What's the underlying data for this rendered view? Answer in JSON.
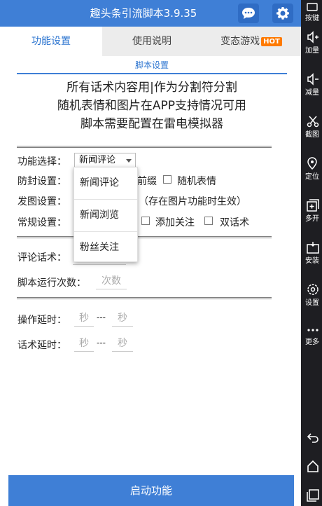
{
  "app": {
    "title": "趣头条引流脚本3.9.35"
  },
  "tabs": [
    {
      "label": "功能设置"
    },
    {
      "label": "使用说明"
    },
    {
      "label": "变态游戏",
      "badge": "HOT"
    }
  ],
  "section_title": "脚本设置",
  "notice": [
    "所有话术内容用|作为分割符分割",
    "随机表情和图片在APP支持情况可用",
    "脚本需要配置在雷电模拟器"
  ],
  "separator": "==========================================",
  "form": {
    "function_label": "功能选择：",
    "function_value": "新闻评论",
    "function_options": [
      "新闻评论",
      "新闻浏览",
      "粉丝关注"
    ],
    "anti_ban_label": "防封设置：",
    "anti_ban_prefix_partial": "前缀",
    "random_emoji": "随机表情",
    "image_label": "发图设置：",
    "image_note": "（存在图片功能时生效）",
    "general_label": "常规设置：",
    "add_follow": "添加关注",
    "double_script": "双话术",
    "comment_script_label": "评论话术：",
    "run_count_label": "脚本运行次数：",
    "run_count_placeholder": "次数",
    "op_delay_label": "操作延时：",
    "script_delay_label": "话术延时：",
    "sec_placeholder": "秒",
    "range_dash": "---"
  },
  "start_button": "启动功能",
  "sidebar": [
    {
      "label": "按键",
      "icon": "keyboard-icon"
    },
    {
      "label": "加量",
      "icon": "volume-up-icon"
    },
    {
      "label": "减量",
      "icon": "volume-down-icon"
    },
    {
      "label": "截图",
      "icon": "scissors-icon"
    },
    {
      "label": "定位",
      "icon": "location-icon"
    },
    {
      "label": "多开",
      "icon": "multi-instance-icon"
    },
    {
      "label": "安装",
      "icon": "apk-install-icon"
    },
    {
      "label": "设置",
      "icon": "settings-gear-icon"
    },
    {
      "label": "更多",
      "icon": "more-dots-icon"
    }
  ],
  "colors": {
    "primary": "#3f7fd6",
    "hot": "#ff7a00",
    "sidebar": "#1e1e22"
  }
}
